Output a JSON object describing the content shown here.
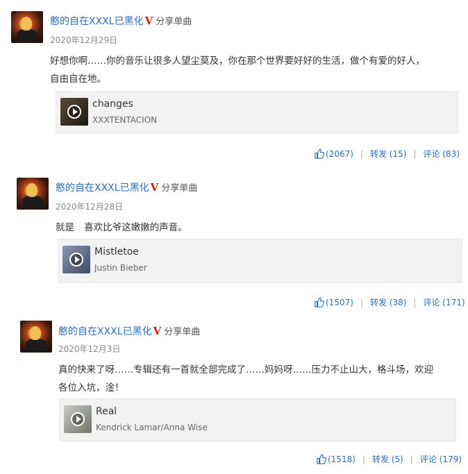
{
  "posts": [
    {
      "username": "憨的自在XXXL已黑化",
      "v_badge": "V",
      "action": "分享单曲",
      "date": "2020年12月29日",
      "text_line1": "好想你啊……你的音乐让很多人望尘莫及，你在那个世界要好好的生活，做个有爱的好人，",
      "text_line2": "自由自在地。",
      "song": {
        "title": "changes",
        "artist": "XXXTENTACION"
      },
      "likes": "(2067)",
      "repost": "转发 (15)",
      "comment": "评论 (83)"
    },
    {
      "username": "憨的自在XXXL已黑化",
      "v_badge": "V",
      "action": "分享单曲",
      "date": "2020年12月28日",
      "text_line1": "就是 ⠀喜欢比爷这嫩嫩的声音。",
      "song": {
        "title": "Mistletoe",
        "artist": "Justin Bieber"
      },
      "likes": "(1507)",
      "repost": "转发 (38)",
      "comment": "评论 (171)"
    },
    {
      "username": "憨的自在XXXL已黑化",
      "v_badge": "V",
      "action": "分享单曲",
      "date": "2020年12月3日",
      "text_line1": "真的快来了呀……专辑还有一首就全部完成了……妈妈呀……压力不止山大，格斗场，欢迎",
      "text_line2": "各位入坑，淦！",
      "song": {
        "title": "Real",
        "artist": "Kendrick Lamar/Anna Wise"
      },
      "likes": "(1518)",
      "repost": "转发 (5)",
      "comment": "评论 (179)"
    }
  ],
  "colors": {
    "link": "#2a6db7",
    "badge": "#d81e06",
    "card_bg": "#f2f2f2"
  },
  "icons": {
    "play": "play-icon",
    "like": "thumbs-up-icon"
  }
}
